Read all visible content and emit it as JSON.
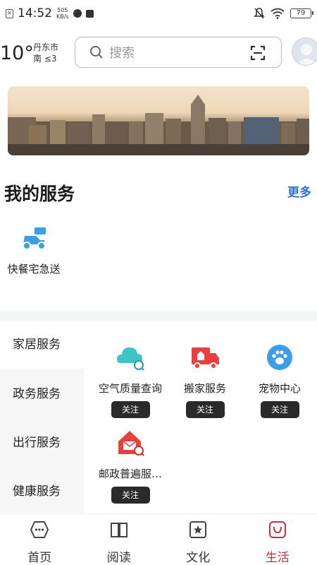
{
  "status_bar": {
    "time": "14:52",
    "speed_top": "505",
    "speed_unit": "KB/s",
    "battery": "79",
    "icons": [
      "notification-icon",
      "record-icon",
      "stop-icon",
      "mute-icon",
      "wifi-icon",
      "battery-icon"
    ]
  },
  "header": {
    "temperature": "10°",
    "city": "丹东市",
    "wind": "南  ≤3",
    "search_placeholder": "搜索",
    "icons": [
      "search-icon",
      "scan-icon",
      "avatar"
    ]
  },
  "my_services": {
    "title": "我的服务",
    "more": "更多",
    "items": [
      {
        "label": "快餐宅急送",
        "icon": "delivery-scooter-icon"
      }
    ]
  },
  "categories": [
    {
      "label": "家居服务",
      "active": true
    },
    {
      "label": "政务服务",
      "active": false
    },
    {
      "label": "出行服务",
      "active": false
    },
    {
      "label": "健康服务",
      "active": false
    }
  ],
  "services": [
    {
      "label": "空气质量查询",
      "button": "关注",
      "icon": "air-quality-icon",
      "color": "#3ec4c4"
    },
    {
      "label": "搬家服务",
      "button": "关注",
      "icon": "moving-truck-icon",
      "color": "#e8403f"
    },
    {
      "label": "宠物中心",
      "button": "关注",
      "icon": "pet-paw-icon",
      "color": "#3b9ee6"
    },
    {
      "label": "邮政普遍服…",
      "button": "关注",
      "icon": "postal-house-icon",
      "color": "#e8403f"
    }
  ],
  "bottom_nav": [
    {
      "label": "首页",
      "icon": "home-icon",
      "active": false
    },
    {
      "label": "阅读",
      "icon": "book-icon",
      "active": false
    },
    {
      "label": "文化",
      "icon": "culture-star-icon",
      "active": false
    },
    {
      "label": "生活",
      "icon": "life-bag-icon",
      "active": true
    }
  ],
  "colors": {
    "accent_red": "#c9303e",
    "link_blue": "#2f6fd6",
    "follow_button": "#2a2a2a"
  }
}
